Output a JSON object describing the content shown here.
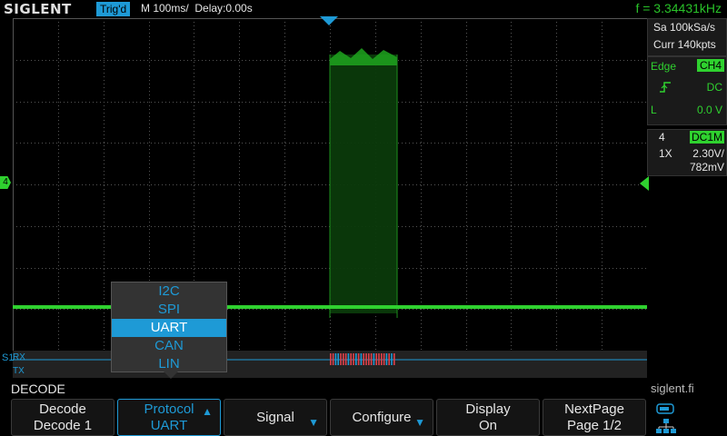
{
  "header": {
    "logo": "SIGLENT",
    "trigger_status": "Trig'd",
    "timebase": "M 100ms/",
    "delay": "Delay:0.00s",
    "frequency": "f = 3.34431kHz"
  },
  "acquisition": {
    "sample_rate": "Sa 100kSa/s",
    "memory": "Curr 140kpts"
  },
  "trigger": {
    "type": "Edge",
    "source": "CH4",
    "coupling": "DC",
    "level_label": "L",
    "level": "0.0 V"
  },
  "channel": {
    "number": "4",
    "coupling": "DC1M",
    "probe": "1X",
    "scale": "2.30V/",
    "offset": "782mV",
    "marker": "4"
  },
  "bus": {
    "index": "S1",
    "rx_label": "RX",
    "tx_label": "TX"
  },
  "menu_title": "DECODE",
  "protocol_menu": {
    "items": [
      "I2C",
      "SPI",
      "UART",
      "CAN",
      "LIN"
    ],
    "selected": "UART"
  },
  "softkeys": [
    {
      "line1": "Decode",
      "line2": "Decode 1"
    },
    {
      "line1": "Protocol",
      "line2": "UART"
    },
    {
      "line1": "Signal",
      "line2": ""
    },
    {
      "line1": "Configure",
      "line2": ""
    },
    {
      "line1": "Display",
      "line2": "On"
    },
    {
      "line1": "NextPage",
      "line2": "Page 1/2"
    }
  ],
  "brand_url": "siglent.fi",
  "colors": {
    "channel4": "#2fd12f",
    "accent": "#1e9ad6",
    "decode_red": "#e0404a"
  }
}
